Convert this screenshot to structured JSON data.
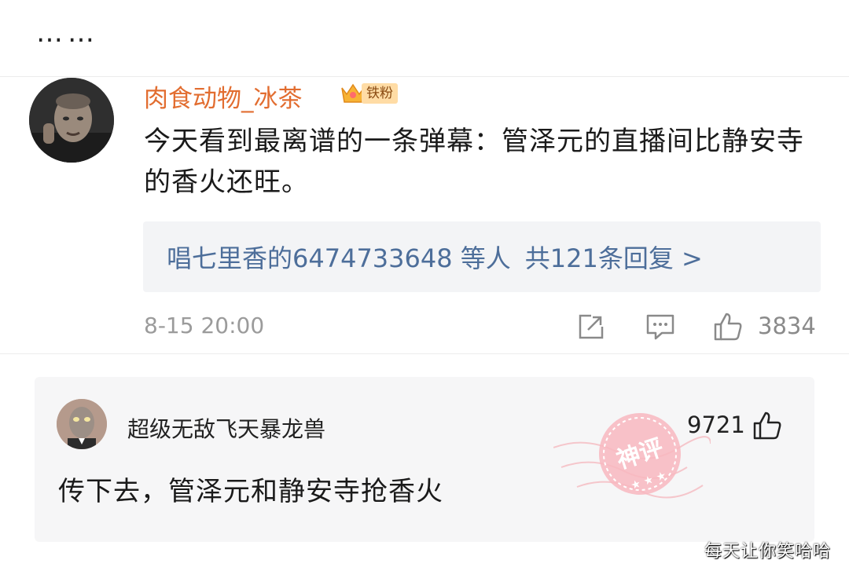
{
  "top": {
    "ellipsis": "……"
  },
  "comment": {
    "username": "肉食动物_冰茶",
    "badge_label": "铁粉",
    "text": "今天看到最离谱的一条弹幕：管泽元的直播间比静安寺的香火还旺。",
    "replies": {
      "users": "唱七里香的6474733648 等人",
      "count": "共121条回复 >"
    },
    "time": "8-15 20:00",
    "likes": "3834"
  },
  "hot_reply": {
    "username": "超级无敌飞天暴龙兽",
    "likes": "9721",
    "text": "传下去，管泽元和静安寺抢香火",
    "stamp_text": "神评"
  },
  "watermark": "每天让你笑哈哈",
  "colors": {
    "username": "#e26d30",
    "reply_link": "#4d6e9a",
    "stamp": "#f2a0a8"
  }
}
